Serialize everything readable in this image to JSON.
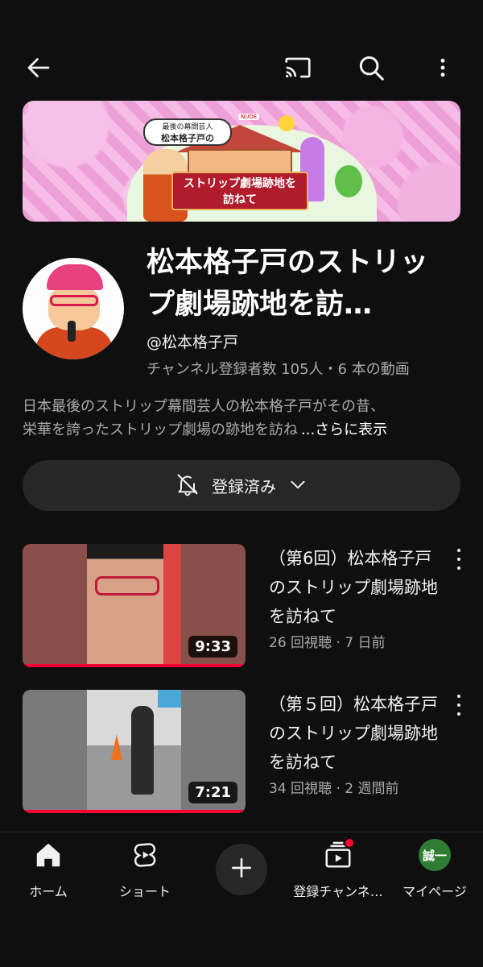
{
  "topbar": {
    "back_icon": "arrow-left-icon",
    "cast_icon": "cast-icon",
    "search_icon": "search-icon",
    "more_icon": "more-vertical-icon"
  },
  "banner": {
    "tag_line1": "最後の幕間芸人",
    "tag_line2": "松本格子戸の",
    "sign_line1": "ストリップ劇場跡地を",
    "sign_line2": "訪ねて",
    "nude_label": "NUDE"
  },
  "channel": {
    "name": "松本格子戸のストリップ劇場跡地を訪…",
    "handle": "@松本格子戸",
    "stats": "チャンネル登録者数 105人・6 本の動画",
    "description_line1": "日本最後のストリップ幕間芸人の松本格子戸がその昔、",
    "description_line2": "栄華を誇ったストリップ劇場の跡地を訪ね",
    "description_more": "...さらに表示"
  },
  "subscribe": {
    "label": "登録済み",
    "bell_icon": "bell-off-icon",
    "chevron_icon": "chevron-down-icon"
  },
  "videos": [
    {
      "title": "（第6回）松本格子戸のストリップ劇場跡地を訪ねて",
      "duration": "9:33",
      "meta": "26 回視聴 · 7 日前"
    },
    {
      "title": "（第５回）松本格子戸のストリップ劇場跡地を訪ねて",
      "duration": "7:21",
      "meta": "34 回視聴 · 2 週間前"
    }
  ],
  "bottom_nav": {
    "home": "ホーム",
    "shorts": "ショート",
    "subscriptions": "登録チャンネ…",
    "me": "マイページ",
    "me_avatar": "誠一"
  },
  "colors": {
    "background": "#0f0f0f",
    "accent_red": "#ff0033",
    "button_bg": "#272727"
  }
}
